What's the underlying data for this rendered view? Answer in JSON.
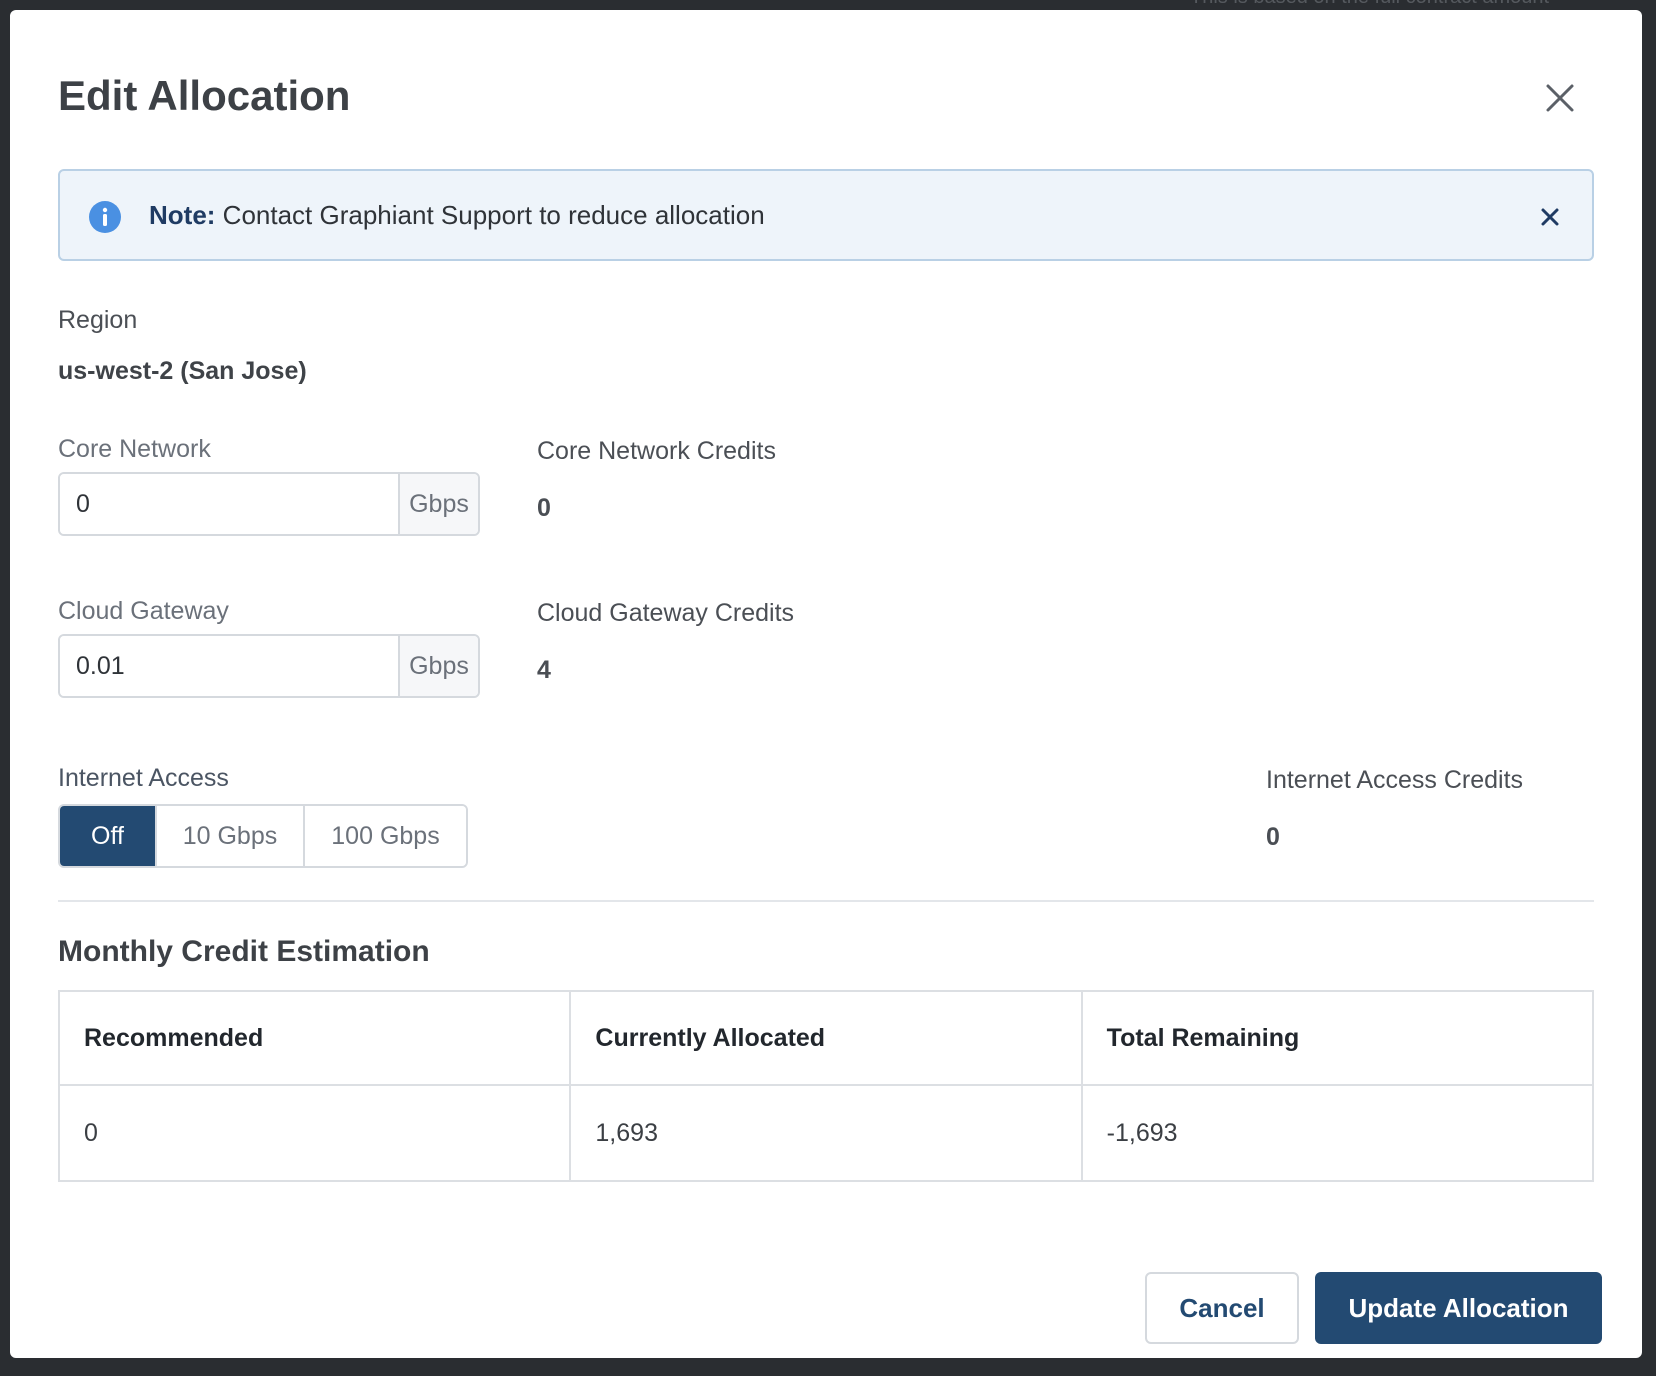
{
  "backdrop": {
    "partial_text": "This is based on the full contract amount"
  },
  "modal": {
    "title": "Edit Allocation",
    "note": {
      "label": "Note:",
      "text": "Contact Graphiant Support to reduce allocation"
    },
    "region": {
      "label": "Region",
      "value": "us-west-2 (San Jose)"
    },
    "core_network": {
      "label": "Core Network",
      "value": "0",
      "unit": "Gbps",
      "credits_label": "Core Network Credits",
      "credits_value": "0"
    },
    "cloud_gateway": {
      "label": "Cloud Gateway",
      "value": "0.01",
      "unit": "Gbps",
      "credits_label": "Cloud Gateway Credits",
      "credits_value": "4"
    },
    "internet_access": {
      "label": "Internet Access",
      "options": [
        "Off",
        "10 Gbps",
        "100 Gbps"
      ],
      "selected": "Off",
      "credits_label": "Internet Access Credits",
      "credits_value": "0"
    },
    "estimation": {
      "title": "Monthly Credit Estimation",
      "headers": [
        "Recommended",
        "Currently Allocated",
        "Total Remaining"
      ],
      "values": [
        "0",
        "1,693",
        "-1,693"
      ]
    },
    "buttons": {
      "cancel": "Cancel",
      "update": "Update Allocation"
    }
  },
  "colors": {
    "primary": "#234a72",
    "info": "#4a90e2",
    "note_bg": "#eef4fa"
  }
}
